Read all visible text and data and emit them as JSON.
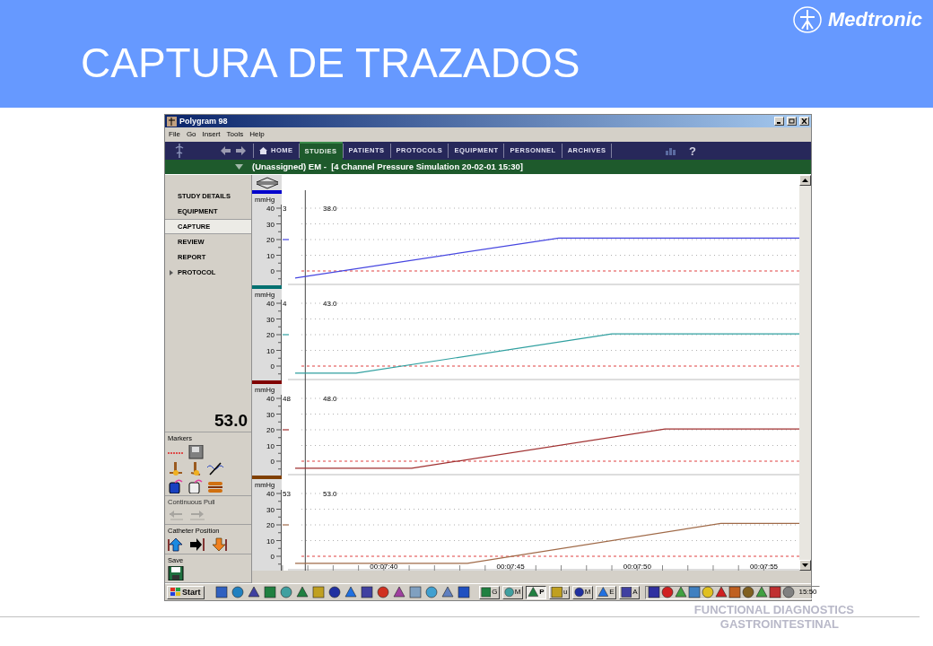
{
  "slide": {
    "title": "CAPTURA DE TRAZADOS",
    "logo_text": "Medtronic",
    "footer": [
      "FUNCTIONAL DIAGNOSTICS",
      "GASTROINTESTINAL"
    ]
  },
  "window": {
    "title": "Polygram 98"
  },
  "menu": [
    "File",
    "Go",
    "Insert",
    "Tools",
    "Help"
  ],
  "nav_tabs": [
    {
      "label": "HOME",
      "kind": "home",
      "selected": false
    },
    {
      "label": "STUDIES",
      "kind": "tab",
      "selected": true
    },
    {
      "label": "PATIENTS",
      "kind": "tab",
      "selected": false
    },
    {
      "label": "PROTOCOLS",
      "kind": "tab",
      "selected": false
    },
    {
      "label": "EQUIPMENT",
      "kind": "tab",
      "selected": false
    },
    {
      "label": "PERSONNEL",
      "kind": "tab",
      "selected": false
    },
    {
      "label": "ARCHIVES",
      "kind": "tab",
      "selected": false
    }
  ],
  "help_label": "?",
  "study_bar": {
    "title": "(Unassigned) EM -  [4 Channel Pressure Simulation 20-02-01 15:30]"
  },
  "sidebar": {
    "items": [
      {
        "label": "STUDY DETAILS",
        "selected": false,
        "expandable": false
      },
      {
        "label": "EQUIPMENT",
        "selected": false,
        "expandable": false
      },
      {
        "label": "CAPTURE",
        "selected": true,
        "expandable": false
      },
      {
        "label": "REVIEW",
        "selected": false,
        "expandable": false
      },
      {
        "label": "REPORT",
        "selected": false,
        "expandable": false
      },
      {
        "label": "PROTOCOL",
        "selected": false,
        "expandable": true
      }
    ],
    "current_value": "53.0",
    "sections": [
      {
        "title": "Markers",
        "kind": "markers",
        "disabled": false
      },
      {
        "title": "Continuous Pull",
        "kind": "pull",
        "disabled": true
      },
      {
        "title": "Catheter Position",
        "kind": "position",
        "disabled": false
      },
      {
        "title": "Save",
        "kind": "save",
        "disabled": false
      }
    ]
  },
  "channels": [
    {
      "unit": "mmHg",
      "color": "#0000cc",
      "cut_label": "3",
      "cursor_label": "38.0",
      "chart_data": {
        "type": "line",
        "grid": true,
        "x": [
          456.5,
          466.9,
          476.4
        ],
        "series": [
          {
            "color": "#4646e0",
            "values": [
              -4.5,
              21,
              21
            ]
          }
        ],
        "xlim": [
          454.8,
          476.4
        ],
        "ylim": [
          -10,
          40
        ],
        "yticks": [
          0,
          10,
          20,
          30,
          40
        ],
        "ref_lines": [
          {
            "axis": "y",
            "value": 0,
            "color": "#e04040"
          },
          {
            "axis": "x",
            "value": 456.9,
            "color": "#444444"
          }
        ]
      }
    },
    {
      "unit": "mmHg",
      "color": "#007070",
      "cut_label": "4",
      "cursor_label": "43.0",
      "chart_data": {
        "type": "line",
        "grid": true,
        "x": [
          456.5,
          458.9,
          469,
          476.4
        ],
        "series": [
          {
            "color": "#30a0a0",
            "values": [
              -4.5,
              -4.5,
              20.5,
              20.5
            ]
          }
        ],
        "xlim": [
          454.8,
          476.4
        ],
        "ylim": [
          -10,
          40
        ],
        "yticks": [
          0,
          10,
          20,
          30,
          40
        ],
        "ref_lines": [
          {
            "axis": "y",
            "value": 0,
            "color": "#e04040"
          },
          {
            "axis": "x",
            "value": 456.9,
            "color": "#444444"
          }
        ]
      }
    },
    {
      "unit": "mmHg",
      "color": "#800000",
      "cut_label": "48",
      "cursor_label": "48.0",
      "chart_data": {
        "type": "line",
        "grid": true,
        "x": [
          456.5,
          461.1,
          471.1,
          476.4
        ],
        "series": [
          {
            "color": "#a03030",
            "values": [
              -4.5,
              -4.5,
              20.5,
              20.5
            ]
          }
        ],
        "xlim": [
          454.8,
          476.4
        ],
        "ylim": [
          -10,
          40
        ],
        "yticks": [
          0,
          10,
          20,
          30,
          40
        ],
        "ref_lines": [
          {
            "axis": "y",
            "value": 0,
            "color": "#e04040"
          },
          {
            "axis": "x",
            "value": 456.9,
            "color": "#444444"
          }
        ]
      }
    },
    {
      "unit": "mmHg",
      "color": "#804000",
      "cut_label": "53",
      "cursor_label": "53.0",
      "chart_data": {
        "type": "line",
        "grid": true,
        "x": [
          456.5,
          463.3,
          473.3,
          476.4
        ],
        "series": [
          {
            "color": "#a06a48",
            "values": [
              -4.5,
              -4.5,
              21,
              21
            ]
          }
        ],
        "xlim": [
          454.8,
          476.4
        ],
        "ylim": [
          -10,
          40
        ],
        "yticks": [
          0,
          10,
          20,
          30,
          40
        ],
        "xticks": [
          {
            "value": 460,
            "label": "00:07:40"
          },
          {
            "value": 465,
            "label": "00:07:45"
          },
          {
            "value": 470,
            "label": "00:07:50"
          },
          {
            "value": 475,
            "label": "00:07:55"
          }
        ],
        "ref_lines": [
          {
            "axis": "y",
            "value": 0,
            "color": "#e04040"
          },
          {
            "axis": "x",
            "value": 456.9,
            "color": "#444444"
          }
        ]
      }
    }
  ],
  "taskbar": {
    "start": "Start",
    "tasks": [
      {
        "label": "G",
        "selected": false
      },
      {
        "label": "M",
        "selected": false
      },
      {
        "label": "P",
        "selected": true
      },
      {
        "label": "u",
        "selected": false
      },
      {
        "label": "M",
        "selected": false
      },
      {
        "label": "E",
        "selected": false
      },
      {
        "label": "A",
        "selected": false
      }
    ],
    "clock": "15:50"
  }
}
